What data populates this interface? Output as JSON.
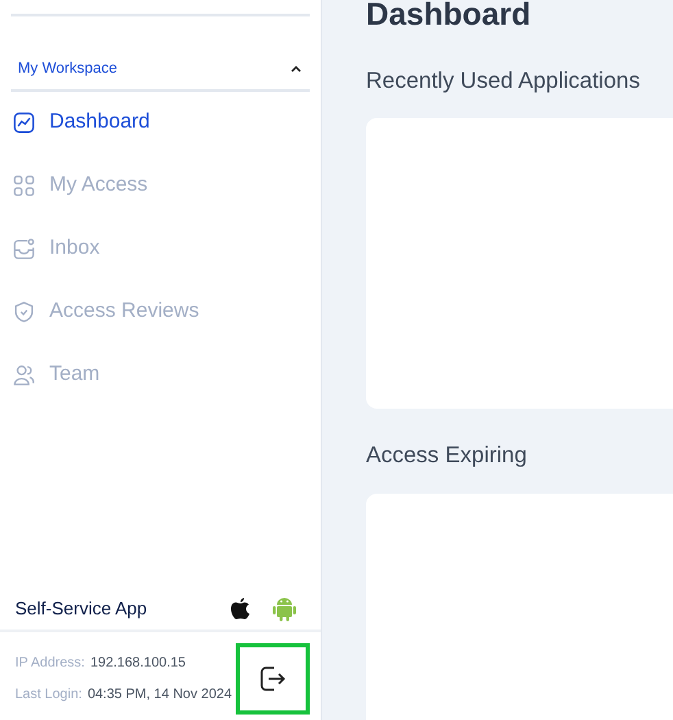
{
  "sidebar": {
    "section": {
      "title": "My Workspace",
      "expanded": true
    },
    "items": [
      {
        "label": "Dashboard",
        "selected": true
      },
      {
        "label": "My Access",
        "selected": false
      },
      {
        "label": "Inbox",
        "selected": false
      },
      {
        "label": "Access Reviews",
        "selected": false
      },
      {
        "label": "Team",
        "selected": false
      }
    ],
    "app": {
      "label": "Self-Service App"
    },
    "footer": {
      "ip_label": "IP Address:",
      "ip": "192.168.100.15",
      "login_label": "Last Login:",
      "login": "04:35 PM, 14 Nov 2024",
      "logout_highlighted": true
    }
  },
  "main": {
    "title": "Dashboard",
    "sections": [
      {
        "title": "Recently Used Applications"
      },
      {
        "title": "Access Expiring"
      }
    ]
  }
}
